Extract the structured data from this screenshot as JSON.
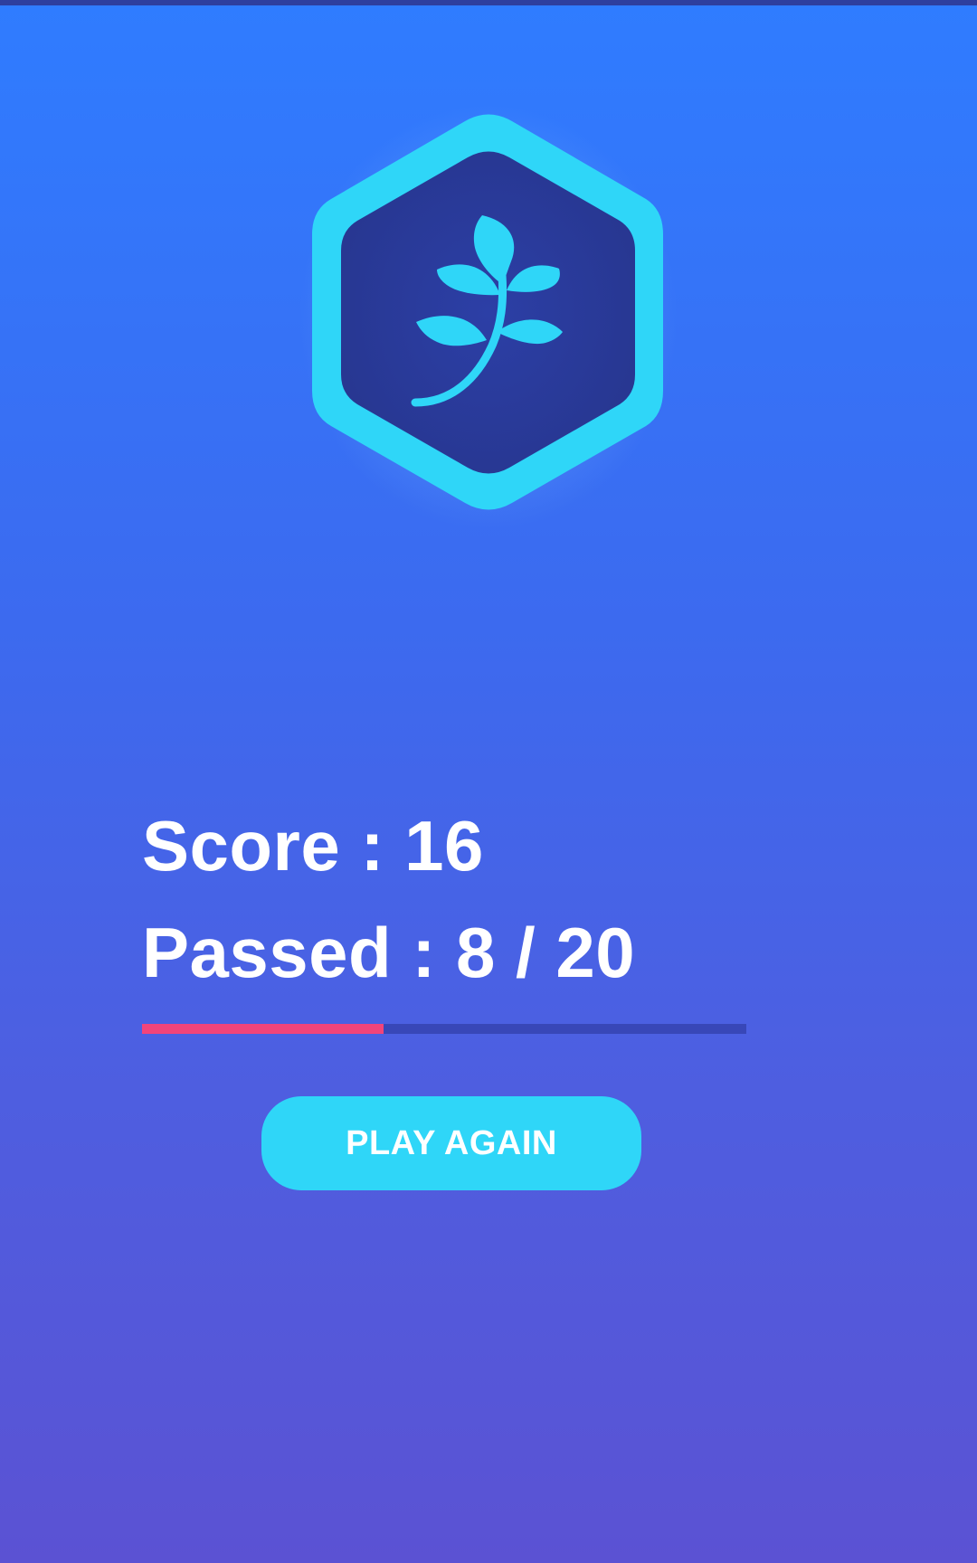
{
  "colors": {
    "background_top": "#2f7cff",
    "background_bottom": "#5b52d3",
    "badge_ring": "#2fd6f8",
    "badge_inner": "#2a3a9a",
    "progress_fill": "#f2447a",
    "progress_track": "#3847b8",
    "button_bg": "#2fd6f8"
  },
  "badge": {
    "icon": "leaf-branch-icon"
  },
  "results": {
    "score_text": "Score : 16",
    "passed_text": "Passed : 8 / 20"
  },
  "progress": {
    "passed": 8,
    "total": 20,
    "fraction": 0.4
  },
  "actions": {
    "play_again_label": "PLAY AGAIN"
  }
}
